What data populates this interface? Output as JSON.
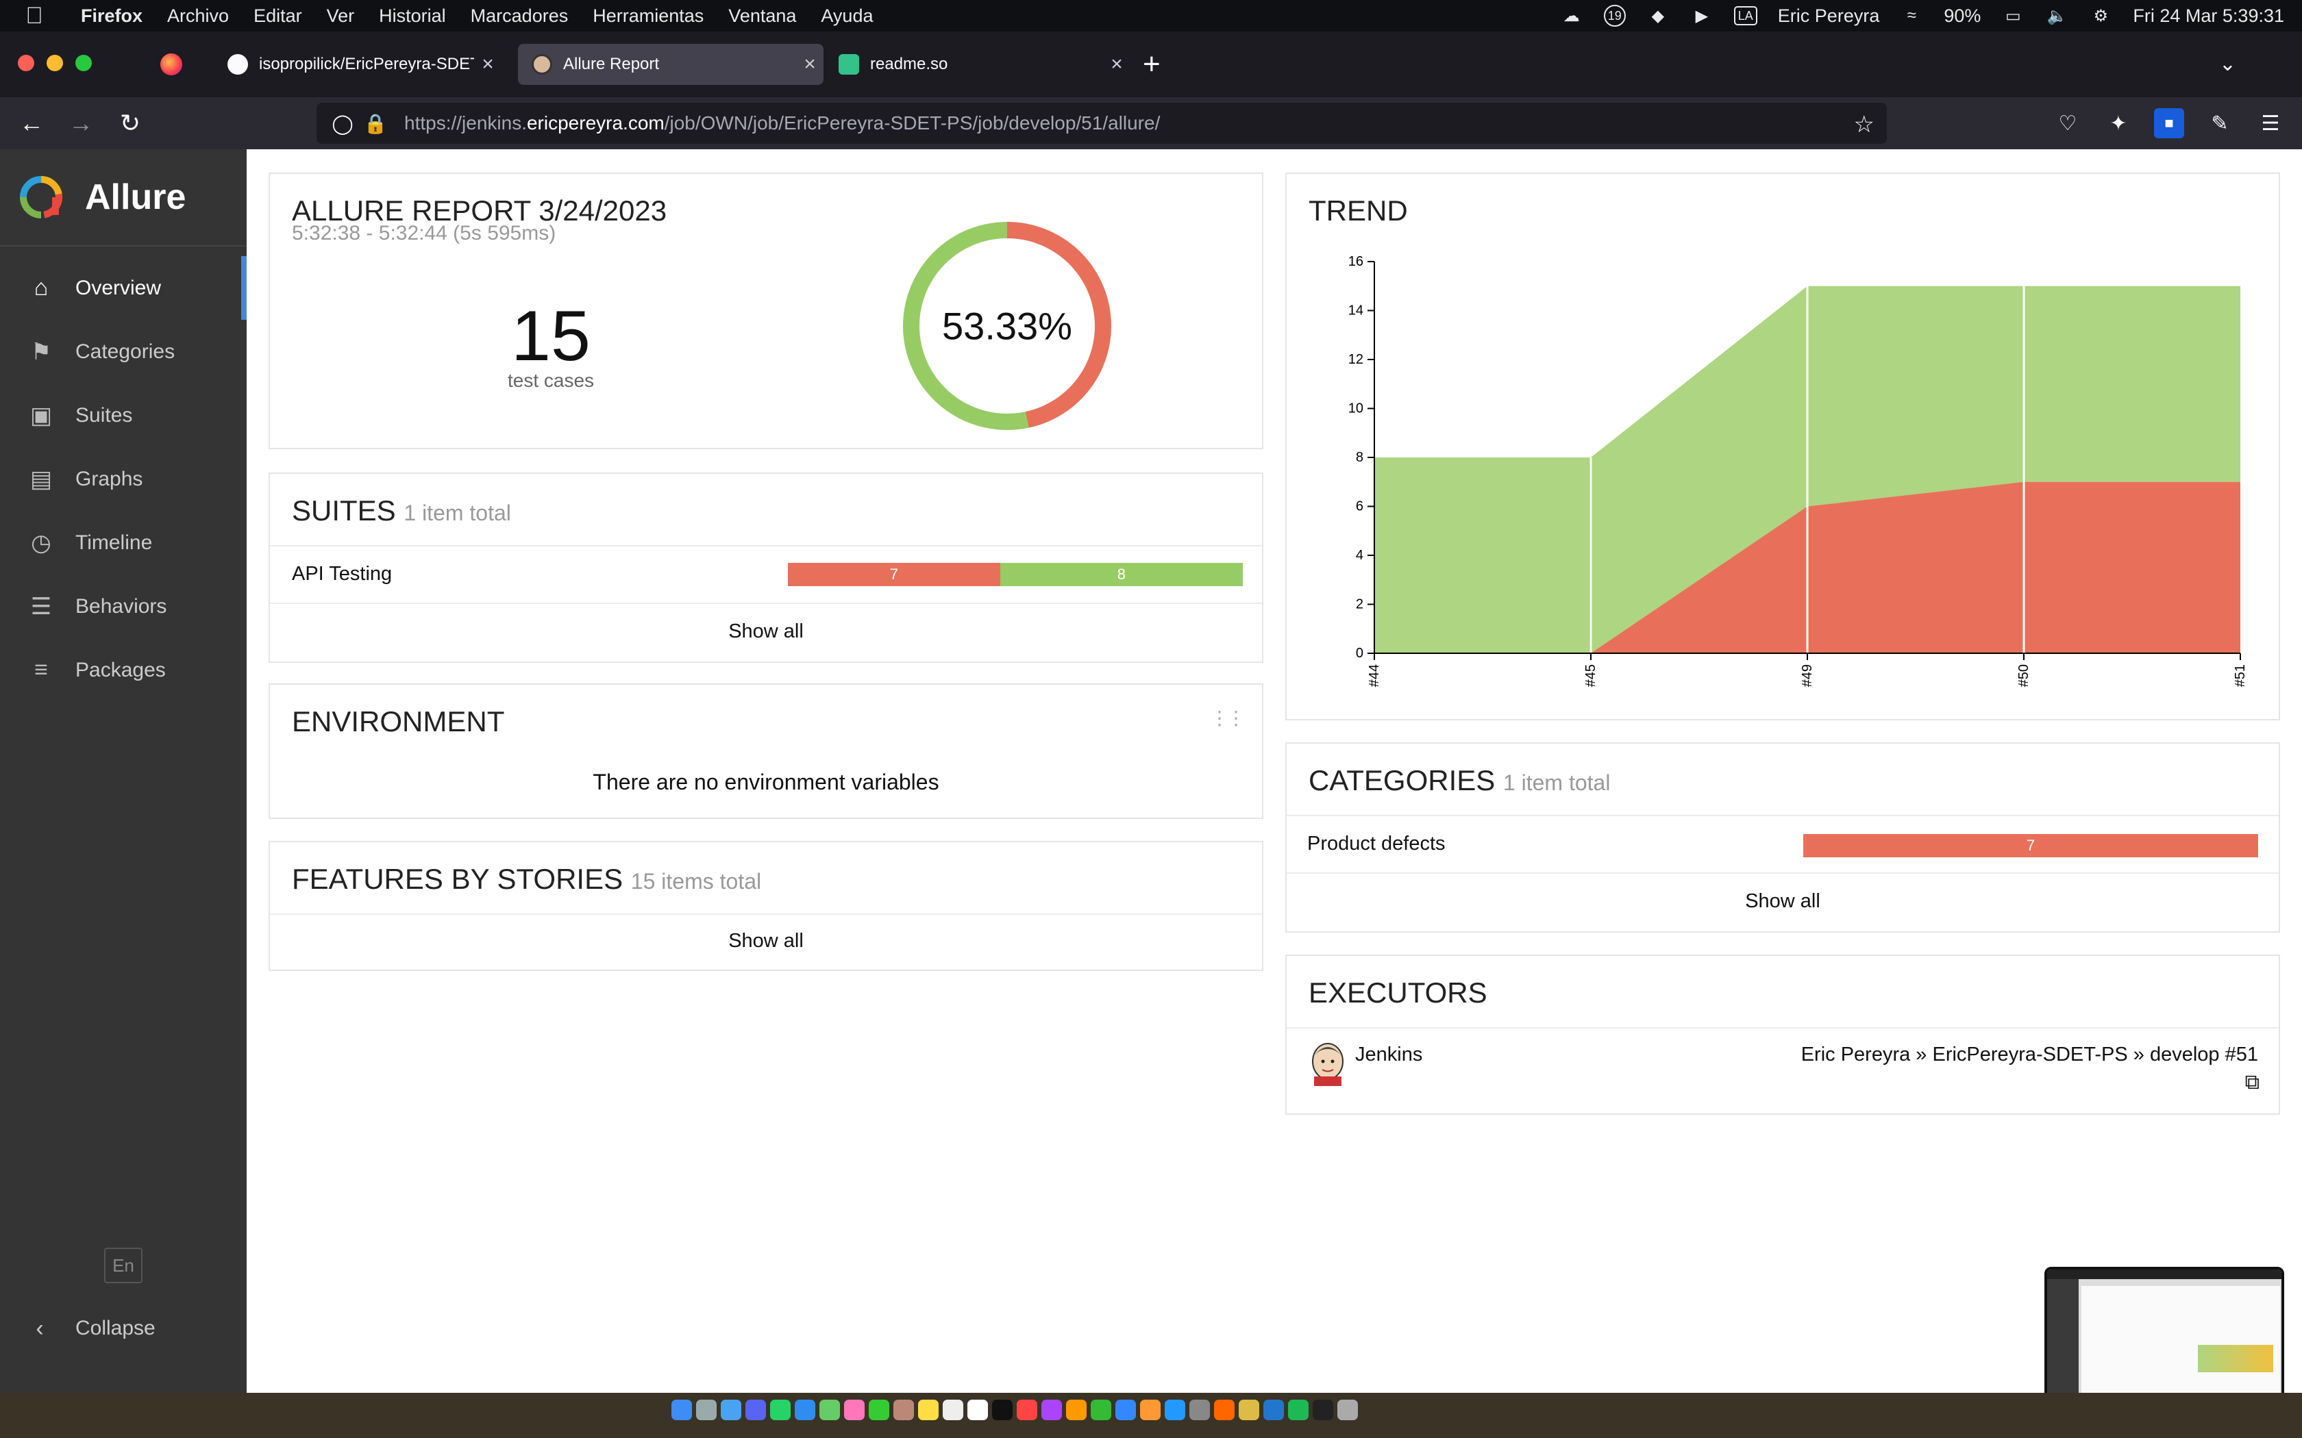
{
  "menubar": {
    "app": "Firefox",
    "items": [
      "Archivo",
      "Editar",
      "Ver",
      "Historial",
      "Marcadores",
      "Herramientas",
      "Ventana",
      "Ayuda"
    ],
    "user": "Eric Pereyra",
    "notification_count": "19",
    "input_source": "LA",
    "battery": "90%",
    "datetime": "Fri 24 Mar  5:39:31"
  },
  "browser": {
    "tabs": [
      {
        "title": "isopropilick/EricPereyra-SDET-PS",
        "icon": "github-icon",
        "active": false
      },
      {
        "title": "Allure Report",
        "icon": "jenkins-icon",
        "active": true
      },
      {
        "title": "readme.so",
        "icon": "readme-icon",
        "active": false
      }
    ],
    "url_prefix": "https://jenkins.",
    "url_domain": "ericpereyra.com",
    "url_path": "/job/OWN/job/EricPereyra-SDET-PS/job/develop/51/allure/"
  },
  "sidebar": {
    "brand": "Allure",
    "items": [
      {
        "label": "Overview",
        "icon": "home-icon",
        "active": true
      },
      {
        "label": "Categories",
        "icon": "flag-icon",
        "active": false
      },
      {
        "label": "Suites",
        "icon": "briefcase-icon",
        "active": false
      },
      {
        "label": "Graphs",
        "icon": "bar-chart-icon",
        "active": false
      },
      {
        "label": "Timeline",
        "icon": "clock-icon",
        "active": false
      },
      {
        "label": "Behaviors",
        "icon": "list-icon",
        "active": false
      },
      {
        "label": "Packages",
        "icon": "align-left-icon",
        "active": false
      }
    ],
    "language": "En",
    "collapse_label": "Collapse"
  },
  "report": {
    "title": "ALLURE REPORT 3/24/2023",
    "time_range": "5:32:38 - 5:32:44 (5s 595ms)",
    "test_cases": "15",
    "test_cases_label": "test cases",
    "pass_rate": "53.33%",
    "passed": 8,
    "failed": 7
  },
  "suites": {
    "title": "SUITES",
    "count": "1 item total",
    "rows": [
      {
        "name": "API Testing",
        "failed": 7,
        "passed": 8,
        "failed_label": "7",
        "passed_label": "8"
      }
    ],
    "show_all": "Show all"
  },
  "environment": {
    "title": "ENVIRONMENT",
    "empty": "There are no environment variables"
  },
  "features": {
    "title": "FEATURES BY STORIES",
    "count": "15 items total",
    "show_all": "Show all"
  },
  "trend": {
    "title": "TREND"
  },
  "categories": {
    "title": "CATEGORIES",
    "count": "1 item total",
    "rows": [
      {
        "name": "Product defects",
        "value": 7,
        "value_label": "7"
      }
    ],
    "show_all": "Show all"
  },
  "executors": {
    "title": "EXECUTORS",
    "name": "Jenkins",
    "path": "Eric Pereyra » EricPereyra-SDET-PS » develop #51"
  },
  "colors": {
    "passed": "#97cc64",
    "failed": "#fd5a3e",
    "failed_area": "#e8705a",
    "passed_area": "#aed581",
    "sidebar_bg": "#343434",
    "accent": "#4b87d0"
  },
  "chart_data": {
    "type": "area",
    "x": [
      "#44",
      "#45",
      "#49",
      "#50",
      "#51"
    ],
    "series": [
      {
        "name": "failed",
        "values": [
          0,
          0,
          6,
          7,
          7
        ]
      },
      {
        "name": "passed",
        "values": [
          8,
          8,
          9,
          8,
          8
        ]
      }
    ],
    "stacked": true,
    "ylim": [
      0,
      16
    ],
    "yticks": [
      0,
      2,
      4,
      6,
      8,
      10,
      12,
      14,
      16
    ],
    "grid": false
  }
}
